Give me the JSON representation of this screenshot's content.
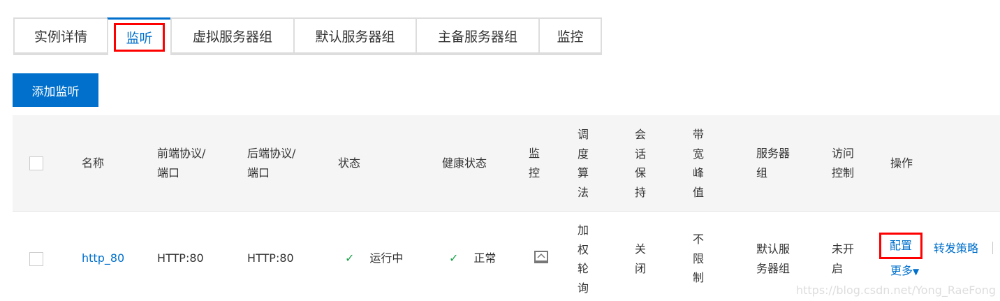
{
  "tabs": [
    "实例详情",
    "监听",
    "虚拟服务器组",
    "默认服务器组",
    "主备服务器组",
    "监控"
  ],
  "add_button": "添加监听",
  "headers": {
    "name": "名称",
    "front": "前端协议/",
    "front2": "端口",
    "back": "后端协议/",
    "back2": "端口",
    "status": "状态",
    "health": "健康状态",
    "monitor": "监控",
    "algo": "调度算法",
    "session": "会话保持",
    "bandwidth": "带宽峰值",
    "group": "服务器",
    "group2": "组",
    "acl": "访问",
    "acl2": "控制",
    "actions": "操作"
  },
  "row": {
    "name": "http_80",
    "front": "HTTP:80",
    "back": "HTTP:80",
    "status": "运行中",
    "health": "正常",
    "algo": "加权轮询",
    "session": "关闭",
    "bandwidth": "不限制",
    "group": "默认服",
    "group2": "务器组",
    "acl": "未开",
    "acl2": "启",
    "config": "配置",
    "forward": "转发策略",
    "more": "更多"
  },
  "watermark": "https://blog.csdn.net/Yong_RaeFong"
}
